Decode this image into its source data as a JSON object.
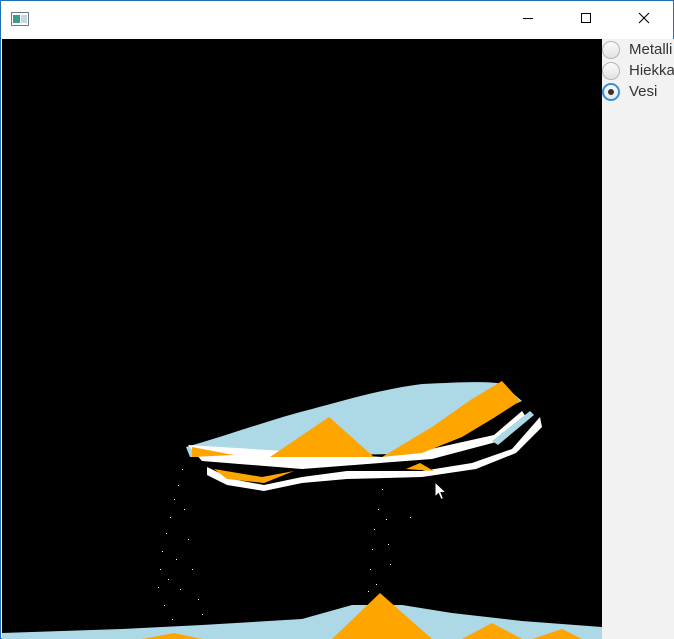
{
  "window": {
    "title": "",
    "icons": {
      "app": "app-window-icon",
      "minimize": "minimize-icon",
      "maximize": "maximize-icon",
      "close": "close-icon"
    }
  },
  "simulation": {
    "background": "#000000",
    "colors": {
      "water": "#add8e6",
      "sand": "#ffa500",
      "metal": "#ffffff"
    }
  },
  "materials": {
    "options": [
      {
        "label": "Metalli",
        "selected": false
      },
      {
        "label": "Hiekka",
        "selected": false
      },
      {
        "label": "Vesi",
        "selected": true
      }
    ]
  }
}
